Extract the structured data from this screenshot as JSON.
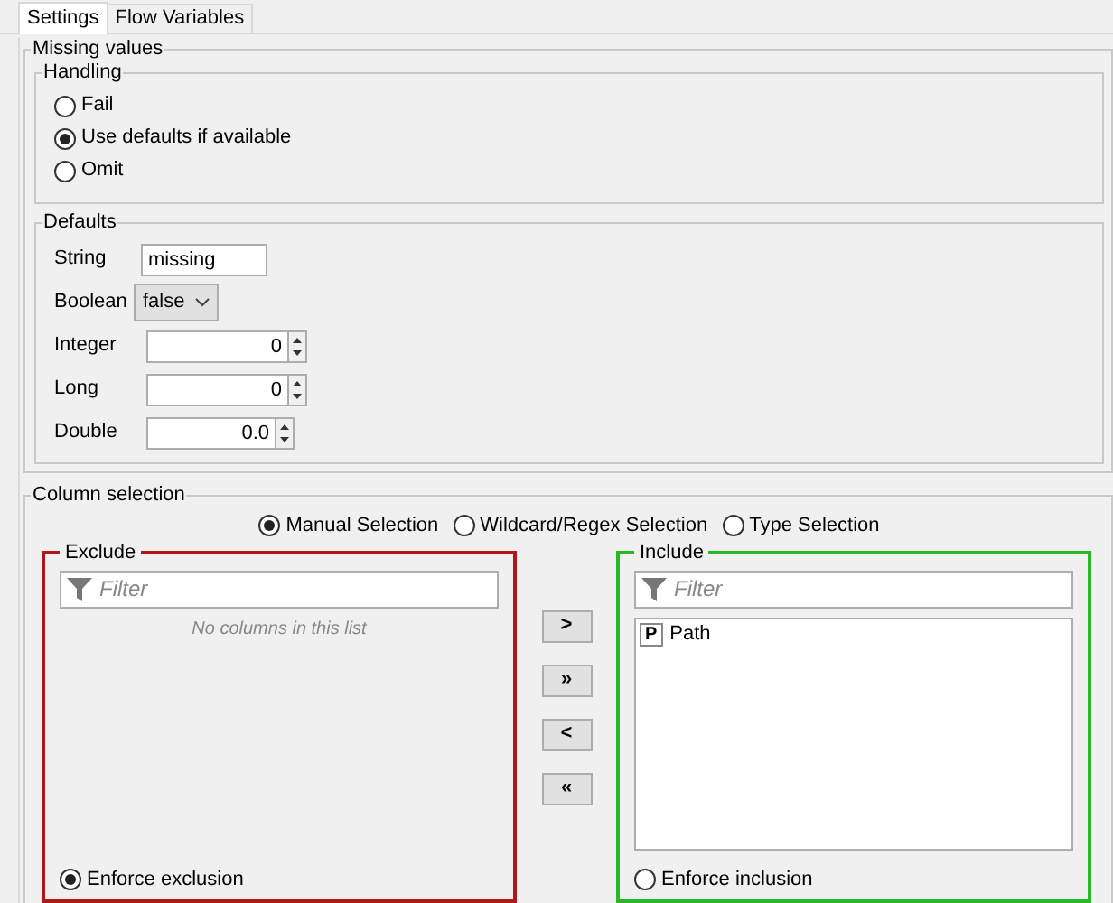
{
  "tabs": [
    {
      "label": "Settings",
      "selected": true
    },
    {
      "label": "Flow Variables",
      "selected": false
    }
  ],
  "missing_values": {
    "title": "Missing values",
    "handling": {
      "title": "Handling",
      "options": [
        {
          "label": "Fail",
          "selected": false
        },
        {
          "label": "Use defaults if available",
          "selected": true
        },
        {
          "label": "Omit",
          "selected": false
        }
      ]
    },
    "defaults": {
      "title": "Defaults",
      "fields": [
        {
          "kind": "text",
          "label": "String",
          "value": "missing"
        },
        {
          "kind": "dropdown",
          "label": "Boolean",
          "value": "false"
        },
        {
          "kind": "spinner",
          "label": "Integer",
          "value": "0"
        },
        {
          "kind": "spinner",
          "label": "Long",
          "value": "0"
        },
        {
          "kind": "spinner",
          "label": "Double",
          "value": "0.0"
        }
      ]
    }
  },
  "column_selection": {
    "title": "Column selection",
    "modes": [
      {
        "label": "Manual Selection",
        "selected": true
      },
      {
        "label": "Wildcard/Regex Selection",
        "selected": false
      },
      {
        "label": "Type Selection",
        "selected": false
      }
    ],
    "exclude": {
      "title": "Exclude",
      "filter_placeholder": "Filter",
      "empty_message": "No columns in this list",
      "enforce": {
        "label": "Enforce exclusion",
        "selected": true
      }
    },
    "move_buttons": [
      ">",
      "»",
      "<",
      "«"
    ],
    "include": {
      "title": "Include",
      "filter_placeholder": "Filter",
      "items": [
        {
          "type_badge": "P",
          "name": "Path"
        }
      ],
      "enforce": {
        "label": "Enforce inclusion",
        "selected": false
      }
    }
  }
}
